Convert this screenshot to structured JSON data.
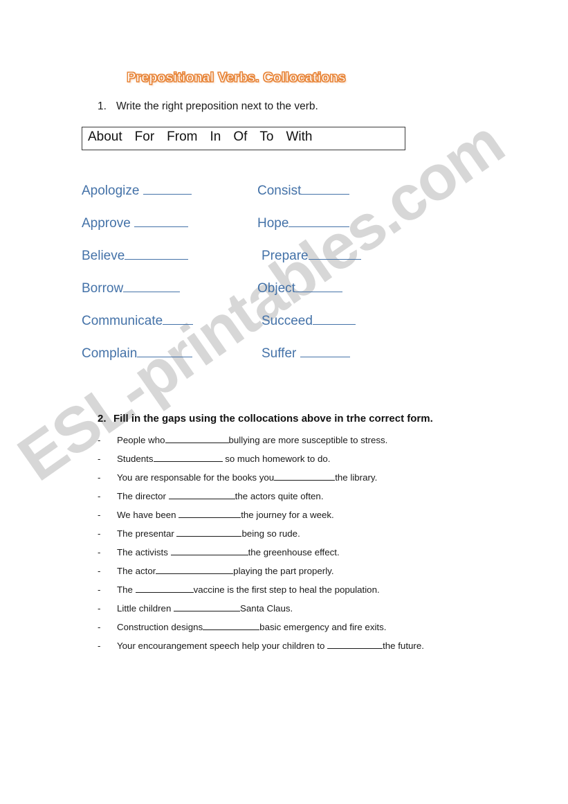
{
  "document": {
    "title": "Prepositional Verbs. Collocations",
    "watermark": "ESL-printables.com",
    "colors": {
      "title_outline": "#E8873C",
      "verb_blue": "#4472A8",
      "body_text": "#1a1a1a",
      "watermark_gray": "#c8c8c8",
      "page_background": "#ffffff"
    }
  },
  "exercise1": {
    "number": "1.",
    "instruction": "Write the right preposition next to the verb.",
    "prepositions": [
      "About",
      "For",
      "From",
      "In",
      "Of",
      "To",
      "With"
    ],
    "left_column": [
      {
        "verb": "Apologize",
        "blank_width": 70,
        "space_before_blank": true
      },
      {
        "verb": "Approve",
        "blank_width": 78,
        "space_before_blank": true
      },
      {
        "verb": "Believe",
        "blank_width": 92,
        "space_before_blank": false
      },
      {
        "verb": "Borrow",
        "blank_width": 82,
        "space_before_blank": false
      },
      {
        "verb": "Communicate",
        "blank_width": 44,
        "space_before_blank": false
      },
      {
        "verb": "Complain",
        "blank_width": 80,
        "space_before_blank": false
      }
    ],
    "right_column": [
      {
        "verb": "Consist",
        "blank_width": 70,
        "space_before_blank": false
      },
      {
        "verb": "Hope",
        "blank_width": 88,
        "space_before_blank": false
      },
      {
        "verb": "Prepare",
        "blank_width": 76,
        "space_before_blank": false
      },
      {
        "verb": "Object",
        "blank_width": 68,
        "space_before_blank": false
      },
      {
        "verb": "Succeed",
        "blank_width": 62,
        "space_before_blank": false
      },
      {
        "verb": "Suffer",
        "blank_width": 72,
        "space_before_blank": true
      }
    ]
  },
  "exercise2": {
    "number": "2.",
    "instruction": "Fill in the gaps using the collocations above in trhe correct form.",
    "bullet": "-",
    "sentences": [
      {
        "before": "People who",
        "blank_width": 92,
        "after": "bullying are more susceptible to stress."
      },
      {
        "before": "Students",
        "blank_width": 100,
        "after": " so much homework to do."
      },
      {
        "before": "You are responsable for the books you",
        "blank_width": 88,
        "after": "the library."
      },
      {
        "before": "The director ",
        "blank_width": 96,
        "after": "the actors quite often."
      },
      {
        "before": "We have been ",
        "blank_width": 90,
        "after": "the journey for a week."
      },
      {
        "before": "The presentar ",
        "blank_width": 94,
        "after": "being so rude."
      },
      {
        "before": "The activists ",
        "blank_width": 112,
        "after": "the greenhouse effect."
      },
      {
        "before": "The actor",
        "blank_width": 112,
        "after": "playing the part properly."
      },
      {
        "before": "The ",
        "blank_width": 84,
        "after": "vaccine is the first step to heal the population."
      },
      {
        "before": "Little children ",
        "blank_width": 96,
        "after": "Santa Claus."
      },
      {
        "before": "Construction designs",
        "blank_width": 82,
        "after": "basic emergency and fire exits."
      },
      {
        "before": "Your encourangement speech help your children to ",
        "blank_width": 80,
        "after": "the future."
      }
    ]
  }
}
